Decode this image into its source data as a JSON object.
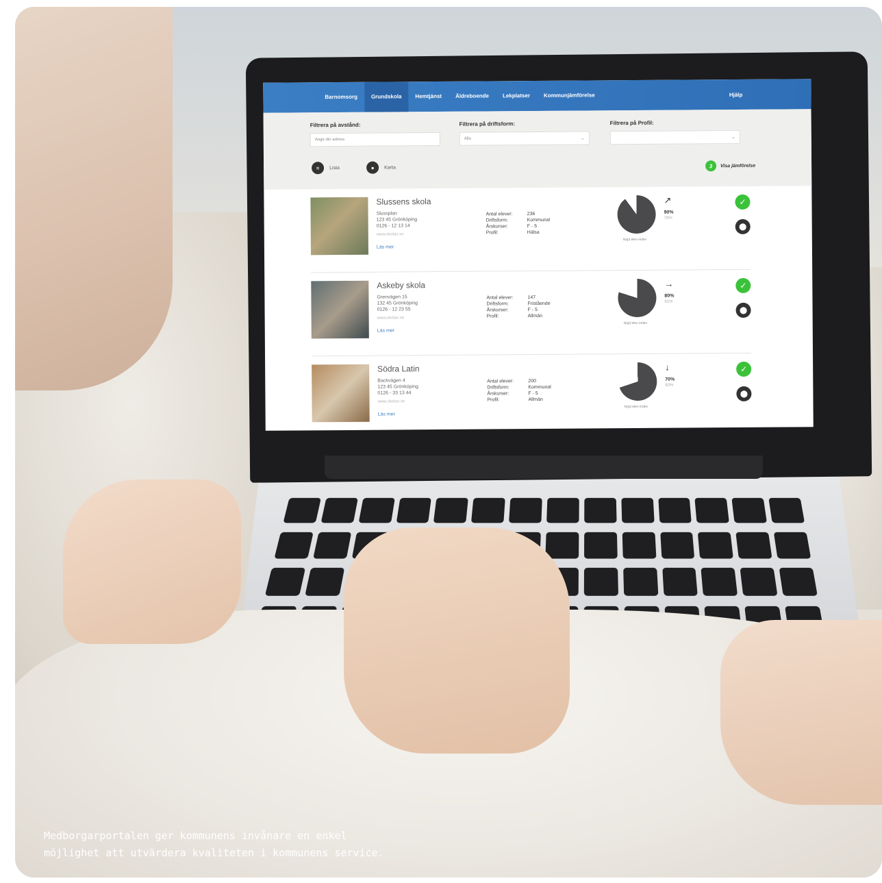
{
  "nav": {
    "items": [
      "Barnomsorg",
      "Grundskola",
      "Hemtjänst",
      "Äldreboende",
      "Lekplatser",
      "Kommunjämförelse"
    ],
    "active_index": 1,
    "help": "Hjälp"
  },
  "filters": {
    "distance": {
      "label": "Filtrera på avstånd:",
      "placeholder": "Ange din adress"
    },
    "operation": {
      "label": "Filtrera på driftsform:",
      "value": "Alla"
    },
    "profile": {
      "label": "Filtrera på Profil:",
      "value": ""
    }
  },
  "views": {
    "list": "Lista",
    "map": "Karta"
  },
  "compare": {
    "count": "3",
    "label": "Visa jämförelse"
  },
  "stat_keys": {
    "students": "Antal elever:",
    "operation": "Driftsform:",
    "grades": "Årskurser:",
    "profile": "Profil:"
  },
  "schools": [
    {
      "name": "Slussens skola",
      "street": "Slussplan",
      "city": "123 45 Grönköping",
      "phone": "0126 - 12 13 14",
      "web": "www.skolan.se",
      "more": "Läs mer",
      "students": "236",
      "operation": "Kommunal",
      "grades": "F - 5",
      "profile": "Hälsa",
      "pct_main": "90%",
      "pct_sub": "79%",
      "pie_fraction": 0.9,
      "trend": "↗",
      "pie_caption": "Nöjd elev-index"
    },
    {
      "name": "Askeby skola",
      "street": "Grenvägen 15",
      "city": "132 45 Grönköping",
      "phone": "0126 - 12 23 55",
      "web": "www.skolan.se",
      "more": "Läs mer",
      "students": "147",
      "operation": "Fristående",
      "grades": "F - 5",
      "profile": "Allmän",
      "pct_main": "80%",
      "pct_sub": "81%",
      "pie_fraction": 0.8,
      "trend": "→",
      "pie_caption": "Nöjd elev-index"
    },
    {
      "name": "Södra Latin",
      "street": "Backvägen 4",
      "city": "123 45 Grönköping",
      "phone": "0126 - 33 13 44",
      "web": "www.skolan.se",
      "more": "Läs mer",
      "students": "200",
      "operation": "Kommunal",
      "grades": "F - 5",
      "profile": "Allmän",
      "pct_main": "70%",
      "pct_sub": "83%",
      "pie_fraction": 0.7,
      "trend": "↓",
      "pie_caption": "Nöjd elev-index"
    }
  ],
  "colors": {
    "nav": "#3b7ec4",
    "check": "#3cc23a",
    "pie": "#4a4a4c"
  },
  "caption": {
    "line1": "Medborgarportalen ger kommunens invånare en enkel",
    "line2": "möjlighet att utvärdera kvaliteten i kommunens service."
  }
}
